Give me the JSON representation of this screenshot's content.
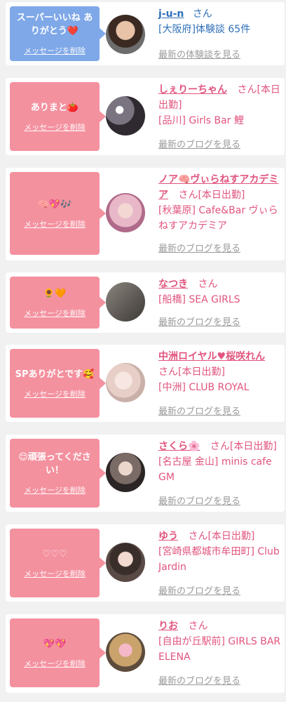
{
  "items": [
    {
      "message": "スーパーいいね ありがとう❤️",
      "delete": "メッセージを削除",
      "name": "j-u-n",
      "suffix": "さん",
      "shop": "[大阪府]体験談 65件",
      "link": "最新の体験談を見る",
      "bubble_color": "#7fa8e8",
      "text_color": "#2e6fb8"
    },
    {
      "message": "ありまと🍅",
      "delete": "メッセージを削除",
      "name": "しぇりーちゃん",
      "suffix": "さん[本日出勤]",
      "shop": "[品川] Girls Bar 鯉",
      "link": "最新のブログを見る",
      "bubble_color": "#f4919f",
      "text_color": "#e1547d"
    },
    {
      "message": "🧠💖🎶",
      "delete": "メッセージを削除",
      "name": "ノア🧠ヴぃらねすアカデミア",
      "suffix": "さん[本日出勤]",
      "shop": "[秋葉原] Cafe&Bar ヴぃらねすアカデミア",
      "link": "最新のブログを見る",
      "bubble_color": "#f4919f",
      "text_color": "#e1547d"
    },
    {
      "message": "🌻🧡",
      "delete": "メッセージを削除",
      "name": "なつき",
      "suffix": "さん",
      "shop": "[船橋] SEA GIRLS",
      "link": "最新のブログを見る",
      "bubble_color": "#f4919f",
      "text_color": "#e1547d"
    },
    {
      "message": "SPありがとです🥰",
      "delete": "メッセージを削除",
      "name": "中洲ロイヤル♥桜咲れん",
      "suffix": "さん[本日出勤]",
      "shop": "[中洲] CLUB ROYAL",
      "link": "最新のブログを見る",
      "bubble_color": "#f4919f",
      "text_color": "#e1547d"
    },
    {
      "message": "😌頑張ってください！",
      "delete": "メッセージを削除",
      "name": "さくら🌸",
      "suffix": "さん[本日出勤]",
      "shop": "[名古屋 金山] minis cafe GM",
      "link": "最新のブログを見る",
      "bubble_color": "#f4919f",
      "text_color": "#e1547d"
    },
    {
      "message": "♡♡♡",
      "delete": "メッセージを削除",
      "name": "ゆう",
      "suffix": "さん[本日出勤]",
      "shop": "[宮崎県都城市牟田町] Club Jardin",
      "link": "最新のブログを見る",
      "bubble_color": "#f4919f",
      "text_color": "#e1547d"
    },
    {
      "message": "💖💖",
      "delete": "メッセージを削除",
      "name": "りお",
      "suffix": "さん",
      "shop": "[自由が丘駅前] GIRLS BAR ELENA",
      "link": "最新のブログを見る",
      "bubble_color": "#f4919f",
      "text_color": "#e1547d"
    }
  ]
}
